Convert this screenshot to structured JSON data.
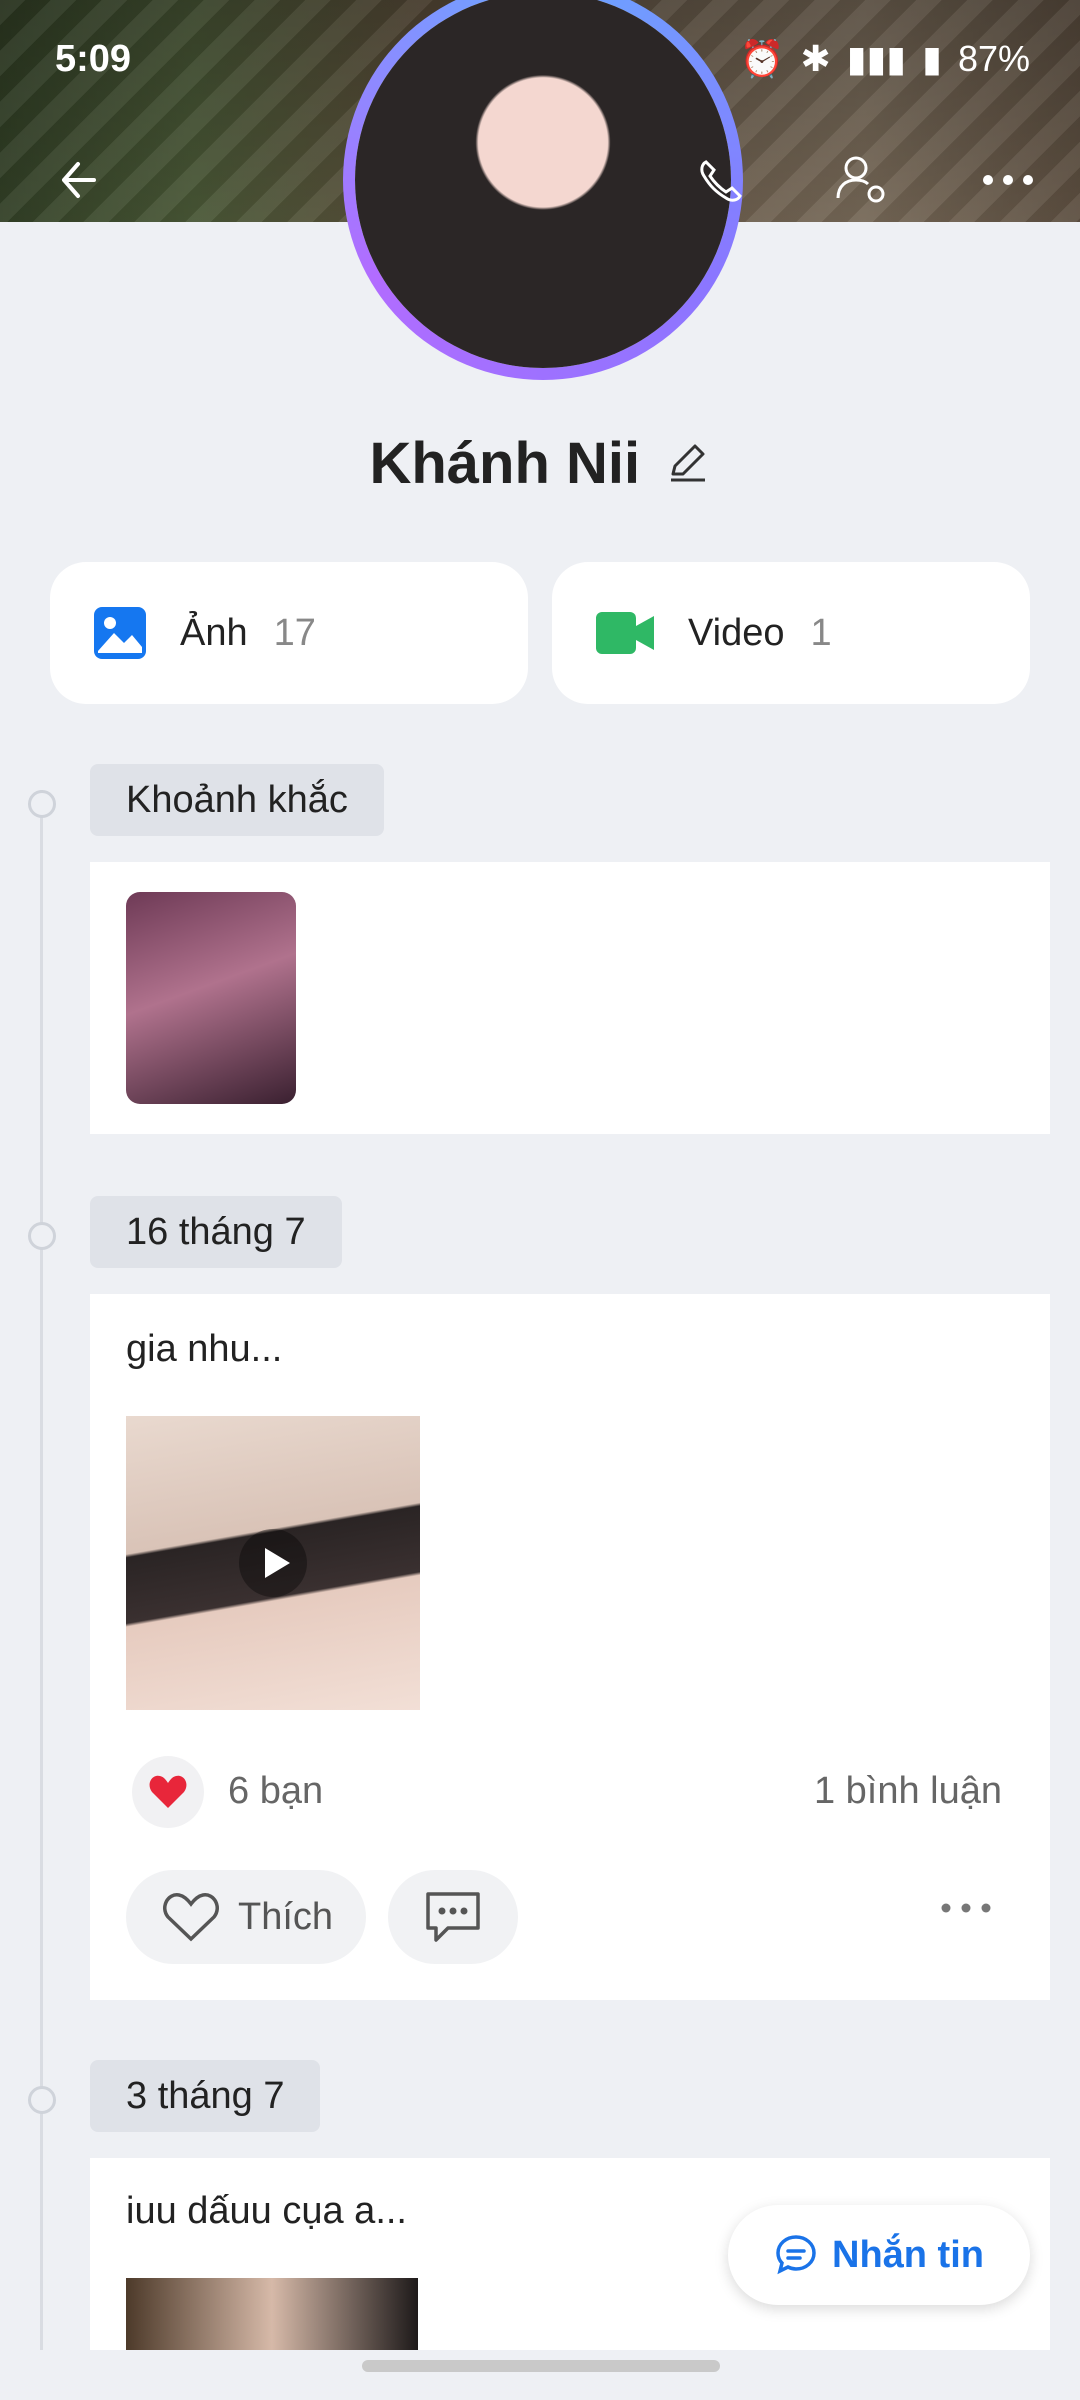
{
  "status": {
    "time": "5:09",
    "battery": "87%",
    "icons": [
      "alarm-icon",
      "vibrate-icon",
      "bluetooth-icon",
      "volte-icon",
      "5g-icon",
      "signal-icon",
      "battery-icon"
    ]
  },
  "profile": {
    "name": "Khánh Nii"
  },
  "media": {
    "photos_label": "Ảnh",
    "photos_count": "17",
    "videos_label": "Video",
    "videos_count": "1"
  },
  "timeline": {
    "moments_label": "Khoảnh khắc",
    "posts": [
      {
        "date": "16 tháng 7",
        "caption": "gia nhu...",
        "reactions": "6 bạn",
        "comments": "1 bình luận",
        "like_label": "Thích"
      },
      {
        "date": "3 tháng 7",
        "caption": "iuu dấuu cụa a..."
      }
    ]
  },
  "actions": {
    "message_label": "Nhắn tin"
  },
  "colors": {
    "accent": "#1a73e8",
    "video_green": "#2fb865",
    "photo_blue": "#1577f0",
    "background": "#eef0f4"
  }
}
